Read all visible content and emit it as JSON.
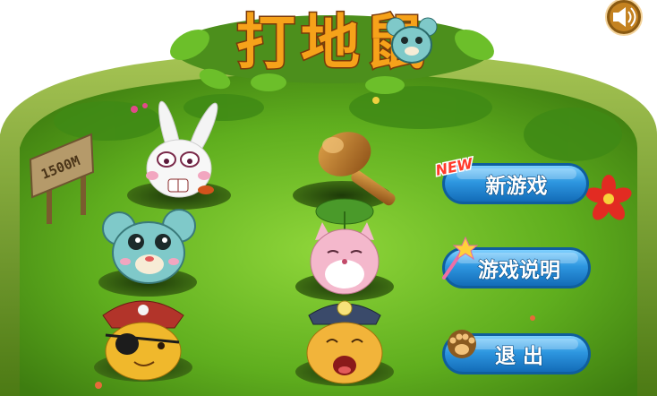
{
  "game": {
    "title": "打地鼠",
    "sign_text": "1500M"
  },
  "menu": {
    "new_badge": "NEW",
    "new_game_label": "新游戏",
    "instructions_label": "游戏说明",
    "exit_label": "退 出"
  },
  "icons": {
    "sound": "speaker-icon",
    "new_game": "new-badge",
    "instructions": "magic-wand-icon",
    "exit": "paw-icon"
  },
  "colors": {
    "grass": "#5aa81c",
    "frame": "#5e8f1a",
    "button": "#2b8fd8",
    "button_border": "#0f5e9e",
    "new_badge": "#e8302a",
    "title_orange": "#f6a21a",
    "title_green": "#6cc520",
    "title_pink": "#e8497a"
  }
}
